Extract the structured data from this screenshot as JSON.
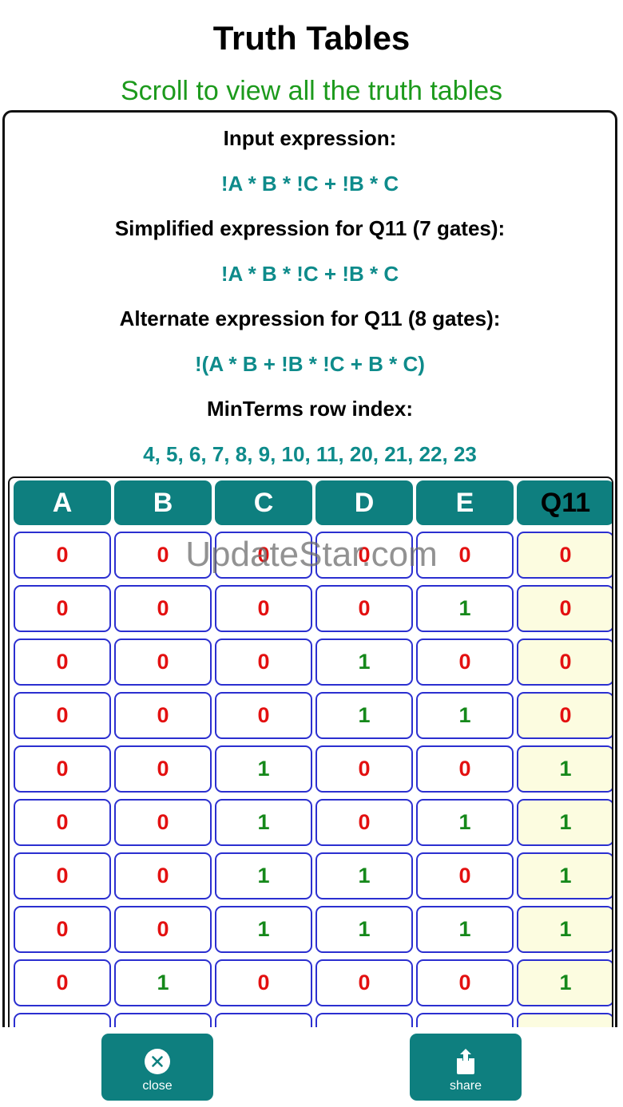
{
  "header": {
    "title": "Truth Tables",
    "scroll_hint": "Scroll to view all the truth tables"
  },
  "expressions": {
    "input_label": "Input expression:",
    "input_value": "!A * B * !C + !B * C",
    "simplified_label": "Simplified expression for Q11 (7 gates):",
    "simplified_value": "!A * B * !C + !B * C",
    "alternate_label": "Alternate expression for Q11 (8 gates):",
    "alternate_value": "!(A * B + !B * !C + B * C)",
    "minterms_label": "MinTerms row index:",
    "minterms_value": "4, 5, 6, 7, 8, 9, 10, 11, 20, 21, 22, 23"
  },
  "table": {
    "headers": [
      "A",
      "B",
      "C",
      "D",
      "E",
      "Q11"
    ],
    "rows": [
      [
        "0",
        "0",
        "0",
        "0",
        "0",
        "0"
      ],
      [
        "0",
        "0",
        "0",
        "0",
        "1",
        "0"
      ],
      [
        "0",
        "0",
        "0",
        "1",
        "0",
        "0"
      ],
      [
        "0",
        "0",
        "0",
        "1",
        "1",
        "0"
      ],
      [
        "0",
        "0",
        "1",
        "0",
        "0",
        "1"
      ],
      [
        "0",
        "0",
        "1",
        "0",
        "1",
        "1"
      ],
      [
        "0",
        "0",
        "1",
        "1",
        "0",
        "1"
      ],
      [
        "0",
        "0",
        "1",
        "1",
        "1",
        "1"
      ],
      [
        "0",
        "1",
        "0",
        "0",
        "0",
        "1"
      ]
    ]
  },
  "watermark": "UpdateStar.com",
  "actions": {
    "close_label": "close",
    "share_label": "share"
  },
  "colors": {
    "accent": "#0e7f7f",
    "expression_text": "#0e8b8b",
    "hint_text": "#1c9a1c",
    "zero": "#e31010",
    "one": "#15881a",
    "cell_border": "#2b2fd0",
    "output_cell_bg": "#fcfce0"
  },
  "icons": {
    "close": "close-circle-icon",
    "share": "share-icon"
  }
}
